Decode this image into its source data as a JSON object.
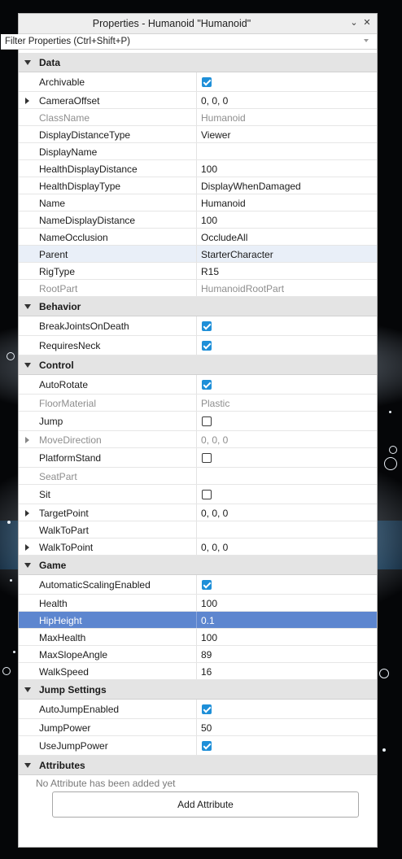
{
  "window": {
    "title": "Properties - Humanoid \"Humanoid\"",
    "menu_icon": "chevron-down-icon",
    "close_icon": "close-icon"
  },
  "filter": {
    "placeholder": "Filter Properties (Ctrl+Shift+P)"
  },
  "colors": {
    "selection": "#5d86cf",
    "highlight": "#e9eff8",
    "checkbox": "#1e8fd8",
    "section_bg": "#e4e4e4"
  },
  "sections": [
    {
      "label": "Data",
      "rows": [
        {
          "name": "Archivable",
          "type": "checkbox",
          "checked": true
        },
        {
          "name": "CameraOffset",
          "value": "0, 0, 0",
          "expandable": true
        },
        {
          "name": "ClassName",
          "value": "Humanoid",
          "readonly": true
        },
        {
          "name": "DisplayDistanceType",
          "value": "Viewer"
        },
        {
          "name": "DisplayName",
          "value": ""
        },
        {
          "name": "HealthDisplayDistance",
          "value": "100"
        },
        {
          "name": "HealthDisplayType",
          "value": "DisplayWhenDamaged"
        },
        {
          "name": "Name",
          "value": "Humanoid"
        },
        {
          "name": "NameDisplayDistance",
          "value": "100"
        },
        {
          "name": "NameOcclusion",
          "value": "OccludeAll"
        },
        {
          "name": "Parent",
          "value": "StarterCharacter",
          "highlighted": true
        },
        {
          "name": "RigType",
          "value": "R15"
        },
        {
          "name": "RootPart",
          "value": "HumanoidRootPart",
          "readonly": true
        }
      ]
    },
    {
      "label": "Behavior",
      "rows": [
        {
          "name": "BreakJointsOnDeath",
          "type": "checkbox",
          "checked": true
        },
        {
          "name": "RequiresNeck",
          "type": "checkbox",
          "checked": true
        }
      ]
    },
    {
      "label": "Control",
      "rows": [
        {
          "name": "AutoRotate",
          "type": "checkbox",
          "checked": true
        },
        {
          "name": "FloorMaterial",
          "value": "Plastic",
          "readonly": true
        },
        {
          "name": "Jump",
          "type": "checkbox",
          "checked": false
        },
        {
          "name": "MoveDirection",
          "value": "0, 0, 0",
          "readonly": true,
          "expandable": true
        },
        {
          "name": "PlatformStand",
          "type": "checkbox",
          "checked": false
        },
        {
          "name": "SeatPart",
          "value": "",
          "readonly": true
        },
        {
          "name": "Sit",
          "type": "checkbox",
          "checked": false
        },
        {
          "name": "TargetPoint",
          "value": "0, 0, 0",
          "expandable": true
        },
        {
          "name": "WalkToPart",
          "value": ""
        },
        {
          "name": "WalkToPoint",
          "value": "0, 0, 0",
          "expandable": true
        }
      ]
    },
    {
      "label": "Game",
      "rows": [
        {
          "name": "AutomaticScalingEnabled",
          "type": "checkbox",
          "checked": true
        },
        {
          "name": "Health",
          "value": "100"
        },
        {
          "name": "HipHeight",
          "value": "0.1",
          "selected": true
        },
        {
          "name": "MaxHealth",
          "value": "100"
        },
        {
          "name": "MaxSlopeAngle",
          "value": "89"
        },
        {
          "name": "WalkSpeed",
          "value": "16"
        }
      ]
    },
    {
      "label": "Jump Settings",
      "rows": [
        {
          "name": "AutoJumpEnabled",
          "type": "checkbox",
          "checked": true
        },
        {
          "name": "JumpPower",
          "value": "50"
        },
        {
          "name": "UseJumpPower",
          "type": "checkbox",
          "checked": true
        }
      ]
    },
    {
      "label": "Attributes",
      "rows": []
    }
  ],
  "attributes": {
    "empty_text": "No Attribute has been added yet",
    "add_button": "Add Attribute"
  }
}
